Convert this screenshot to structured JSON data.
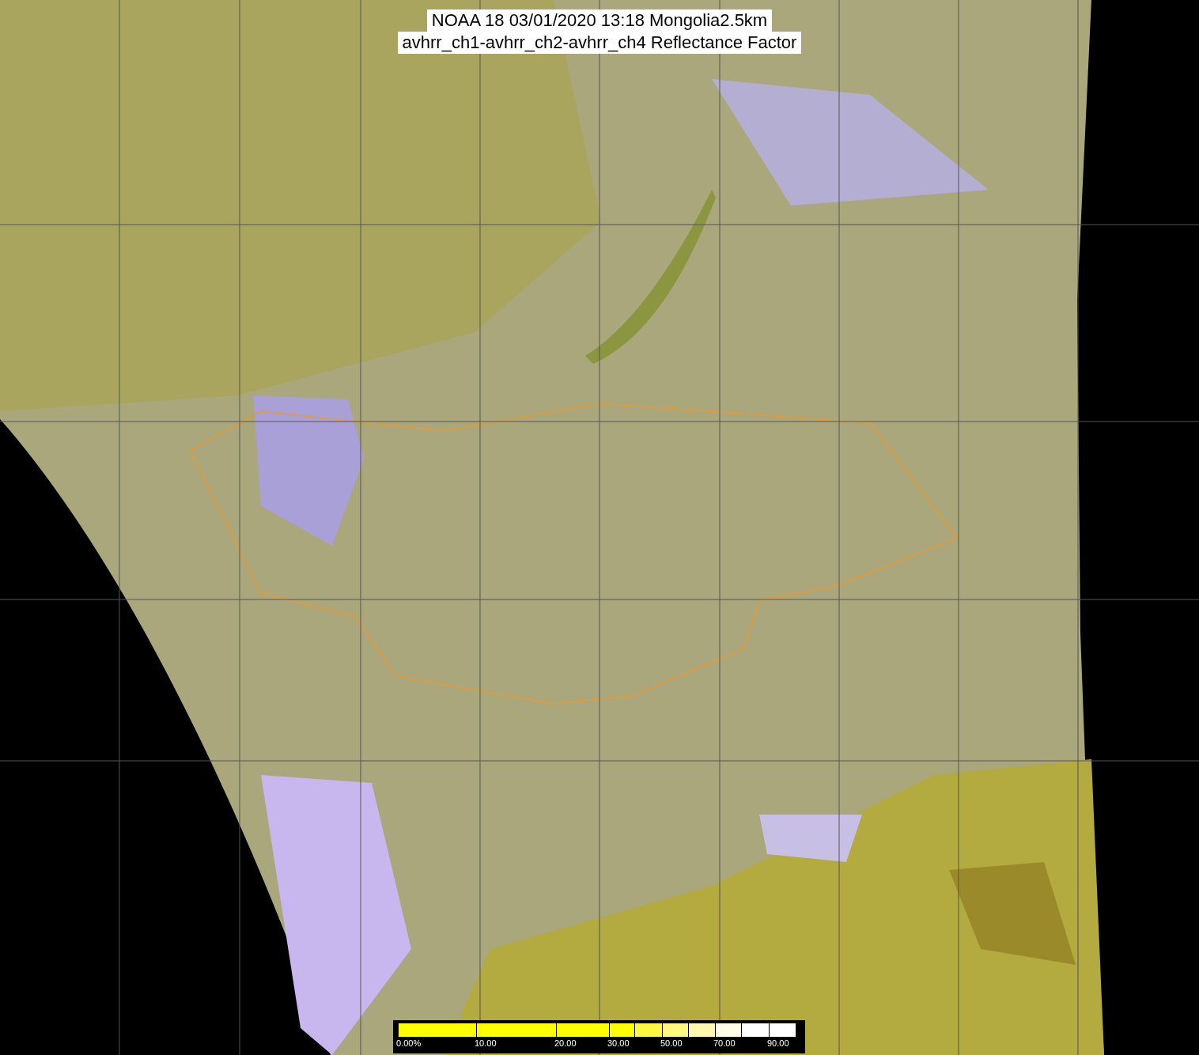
{
  "title": {
    "lines": [
      "NOAA 18 03/01/2020 13:18 Mongolia2.5km",
      "avhrr_ch1-avhrr_ch2-avhrr_ch4 Reflectance Factor"
    ]
  },
  "legend": {
    "segments": [
      {
        "color": "#ffff00",
        "label": "0.00%"
      },
      {
        "color": "#ffff00",
        "label": "10.00"
      },
      {
        "color": "#ffff00",
        "label": "20.00"
      },
      {
        "color": "#ffff00",
        "label": "30.00"
      },
      {
        "color": "#fff840"
      },
      {
        "color": "#fff880",
        "label": "50.00"
      },
      {
        "color": "#fffab0"
      },
      {
        "color": "#fffde8",
        "label": "70.00"
      },
      {
        "color": "#ffffff"
      },
      {
        "color": "#ffffff",
        "label": "90.00"
      }
    ]
  }
}
